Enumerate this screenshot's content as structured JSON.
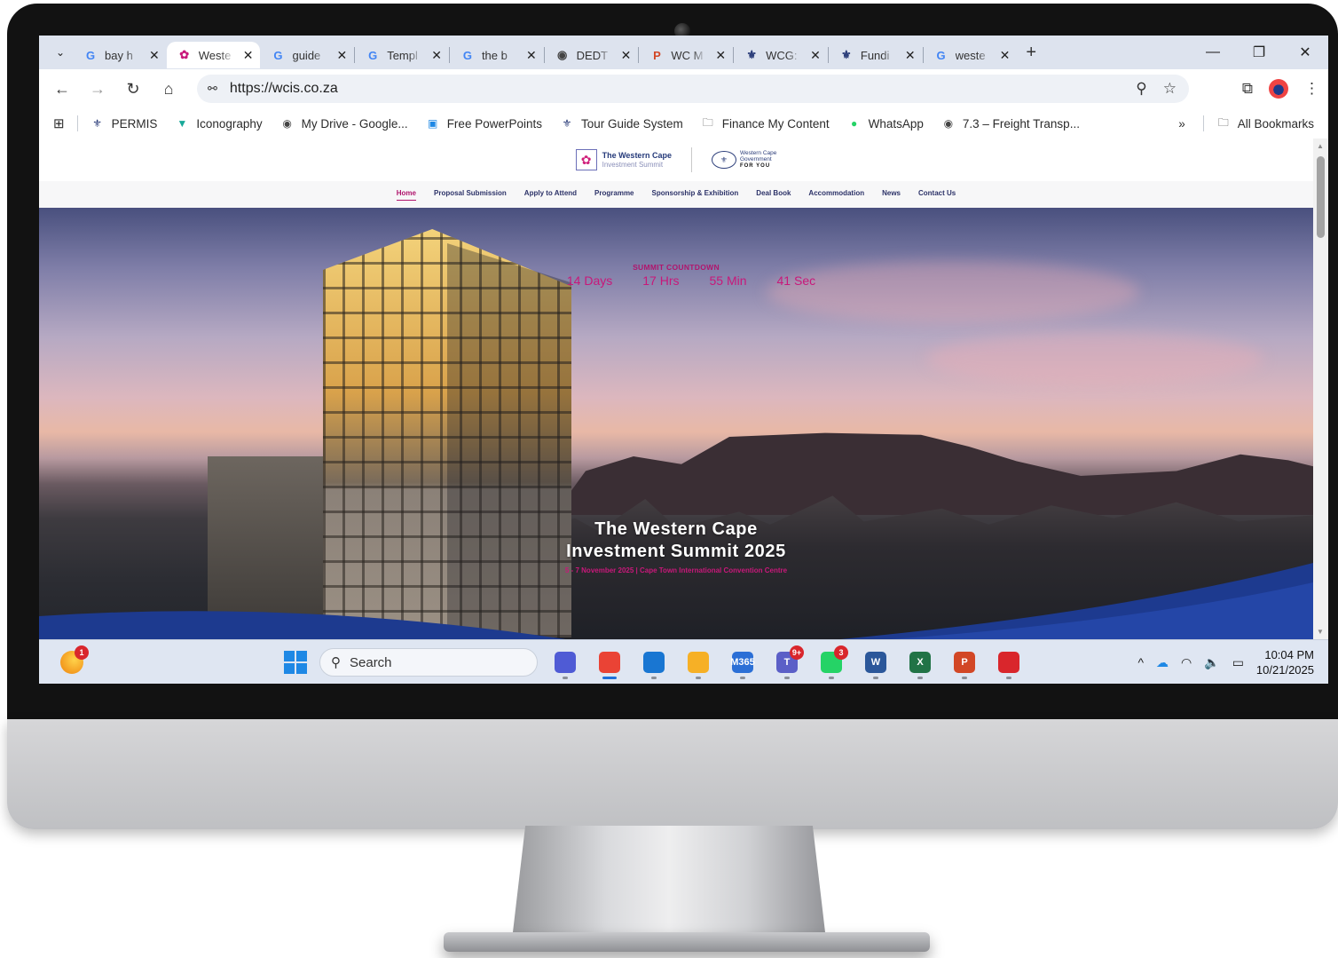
{
  "browser": {
    "tabs": [
      {
        "label": "bay h",
        "icon": "google-icon",
        "active": false
      },
      {
        "label": "Weste",
        "icon": "wcis-icon",
        "active": true
      },
      {
        "label": "guide",
        "icon": "google-icon",
        "active": false
      },
      {
        "label": "Templ",
        "icon": "google-icon",
        "active": false
      },
      {
        "label": "the b",
        "icon": "google-icon",
        "active": false
      },
      {
        "label": "DEDT",
        "icon": "globe-icon",
        "active": false
      },
      {
        "label": "WC M",
        "icon": "powerpoint-icon",
        "active": false
      },
      {
        "label": "WCG:",
        "icon": "wcg-seal-icon",
        "active": false
      },
      {
        "label": "Fundi",
        "icon": "wcg-seal-icon",
        "active": false
      },
      {
        "label": "weste",
        "icon": "google-icon",
        "active": false
      }
    ],
    "url": "https://wcis.co.za",
    "bookmarks": [
      {
        "label": "PERMIS",
        "icon": "wcg-seal-icon"
      },
      {
        "label": "Iconography",
        "icon": "vector-icon"
      },
      {
        "label": "My Drive - Google...",
        "icon": "globe-icon"
      },
      {
        "label": "Free PowerPoints",
        "icon": "slides-icon"
      },
      {
        "label": "Tour Guide System",
        "icon": "wcg-seal-icon"
      },
      {
        "label": "Finance My Content",
        "icon": "folder-icon"
      },
      {
        "label": "WhatsApp",
        "icon": "whatsapp-icon"
      },
      {
        "label": "7.3 – Freight Transp...",
        "icon": "globe-icon"
      }
    ],
    "bookmarks_more": "»",
    "all_bookmarks": "All Bookmarks"
  },
  "site": {
    "logo_main_line1": "The Western Cape",
    "logo_main_line2": "Investment Summit",
    "logo_gov_line1": "Western Cape",
    "logo_gov_line2": "Government",
    "logo_gov_line3": "FOR YOU",
    "nav": [
      {
        "label": "Home",
        "active": true
      },
      {
        "label": "Proposal Submission",
        "active": false
      },
      {
        "label": "Apply to Attend",
        "active": false
      },
      {
        "label": "Programme",
        "active": false
      },
      {
        "label": "Sponsorship & Exhibition",
        "active": false
      },
      {
        "label": "Deal Book",
        "active": false
      },
      {
        "label": "Accommodation",
        "active": false
      },
      {
        "label": "News",
        "active": false
      },
      {
        "label": "Contact Us",
        "active": false
      }
    ],
    "countdown": {
      "title": "SUMMIT COUNTDOWN",
      "days": "14 Days",
      "hours": "17 Hrs",
      "minutes": "55 Min",
      "seconds": "41 Sec"
    },
    "hero_title_line1": "The Western Cape",
    "hero_title_line2": "Investment Summit 2025",
    "hero_subtitle": "5 - 7 November 2025 | Cape Town International Convention Centre"
  },
  "taskbar": {
    "weather_badge": "1",
    "search_placeholder": "Search",
    "apps": [
      {
        "name": "meet-icon",
        "label": "",
        "color": "#4f5bd5",
        "badge": ""
      },
      {
        "name": "chrome-icon",
        "label": "",
        "color": "#ea4335",
        "badge": ""
      },
      {
        "name": "outlook-icon",
        "label": "",
        "color": "#1976d2",
        "badge": ""
      },
      {
        "name": "file-explorer-icon",
        "label": "",
        "color": "#f6b026",
        "badge": ""
      },
      {
        "name": "m365-icon",
        "label": "M365",
        "color": "#2b6fd6",
        "badge": ""
      },
      {
        "name": "teams-icon",
        "label": "T",
        "color": "#5b5fc7",
        "badge": "9+"
      },
      {
        "name": "whatsapp-icon",
        "label": "",
        "color": "#25d366",
        "badge": "3"
      },
      {
        "name": "word-icon",
        "label": "W",
        "color": "#2b579a",
        "badge": ""
      },
      {
        "name": "excel-icon",
        "label": "X",
        "color": "#217346",
        "badge": ""
      },
      {
        "name": "powerpoint-icon",
        "label": "P",
        "color": "#d24726",
        "badge": ""
      },
      {
        "name": "acrobat-icon",
        "label": "",
        "color": "#d9262c",
        "badge": ""
      }
    ],
    "time": "10:04 PM",
    "date": "10/21/2025"
  },
  "colors": {
    "accent_magenta": "#c8187a",
    "nav_text": "#2c3268",
    "hero_wave": "#1d3a8f"
  }
}
